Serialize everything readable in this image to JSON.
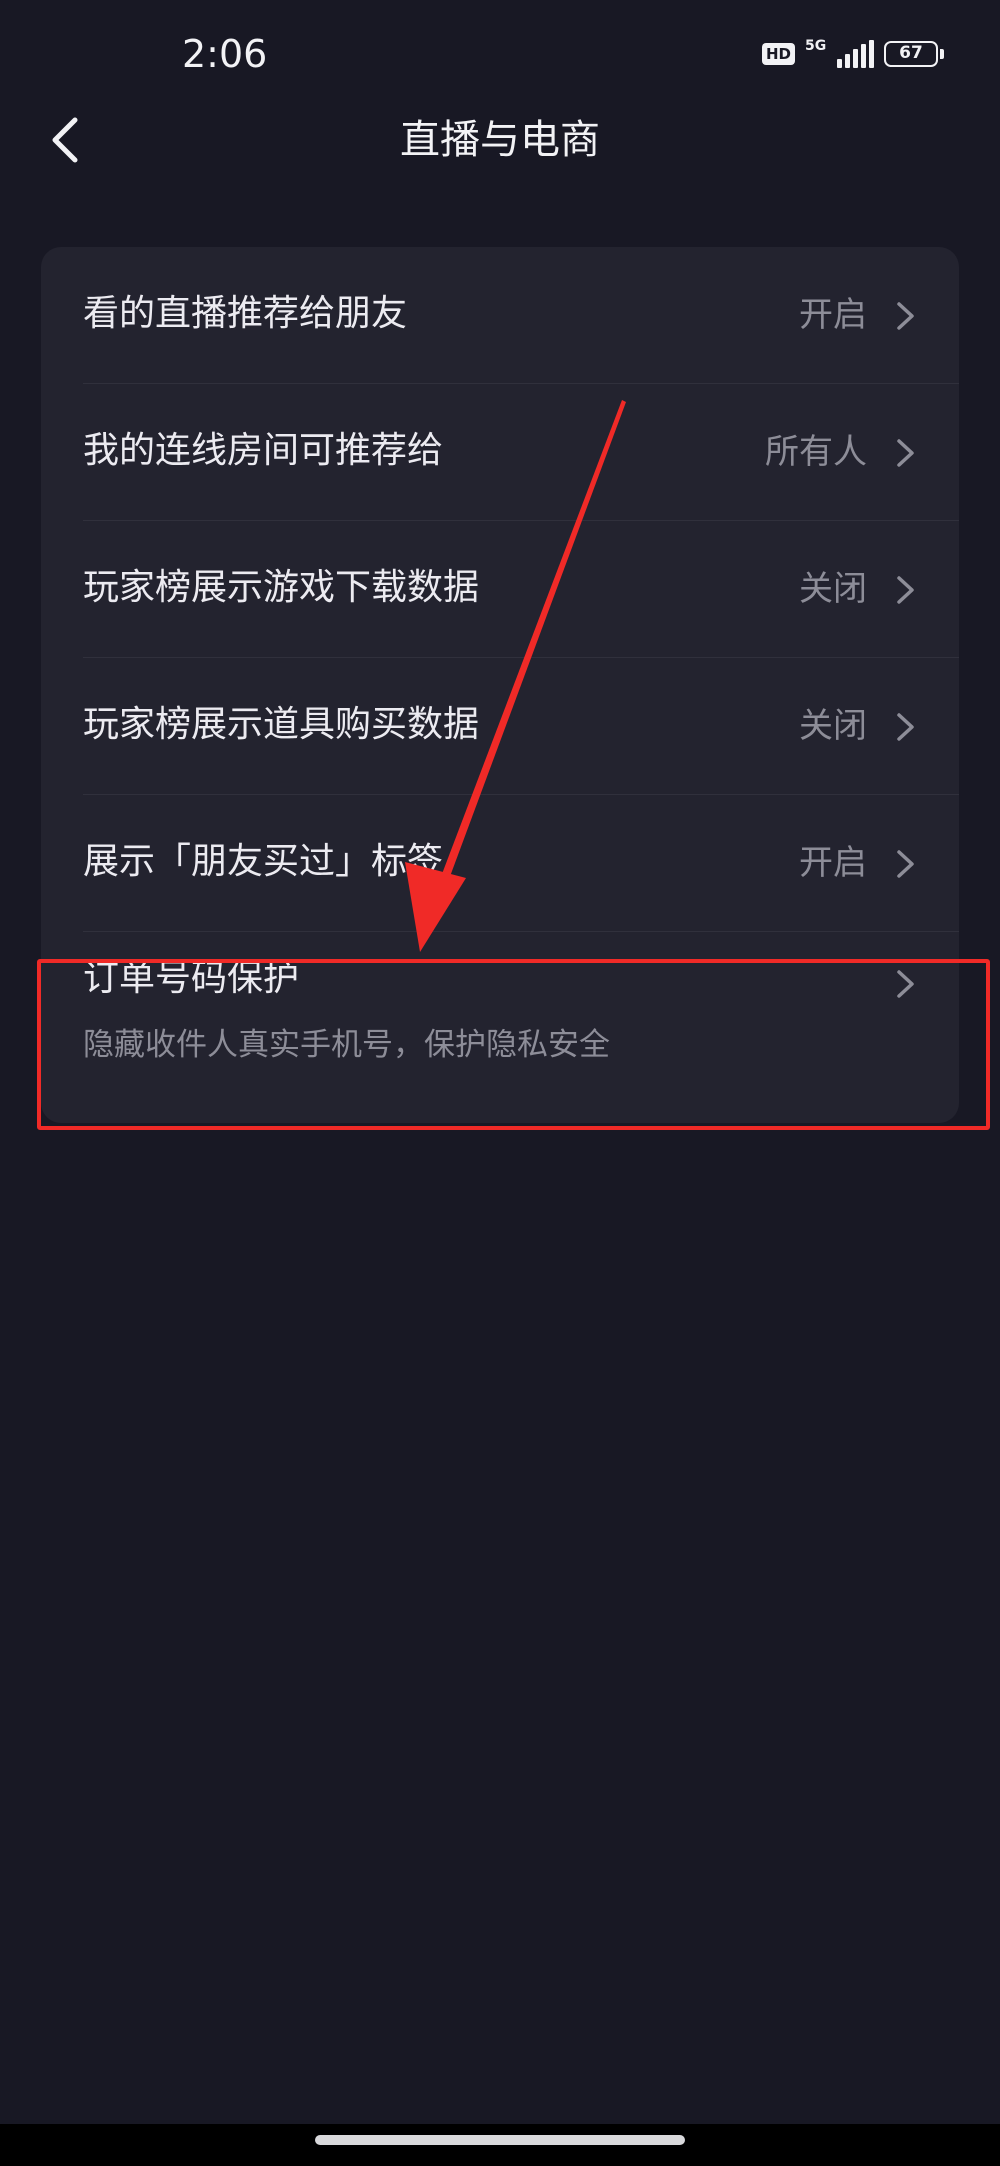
{
  "status_bar": {
    "time": "2:06",
    "hd_badge": "HD",
    "network": "5G",
    "battery": "67"
  },
  "header": {
    "back_icon": "chevron-left-icon",
    "title": "直播与电商"
  },
  "settings": [
    {
      "label": "看的直播推荐给朋友",
      "value": "开启"
    },
    {
      "label": "我的连线房间可推荐给",
      "value": "所有人"
    },
    {
      "label": "玩家榜展示游戏下载数据",
      "value": "关闭"
    },
    {
      "label": "玩家榜展示道具购买数据",
      "value": "关闭"
    },
    {
      "label": "展示「朋友买过」标签",
      "value": "开启"
    }
  ],
  "order_protection": {
    "label": "订单号码保护",
    "description": "隐藏收件人真实手机号，保护隐私安全"
  },
  "colors": {
    "background": "#181824",
    "card": "#23232f",
    "annotation_red": "#f02a27",
    "secondary_text": "#8d8d98"
  }
}
